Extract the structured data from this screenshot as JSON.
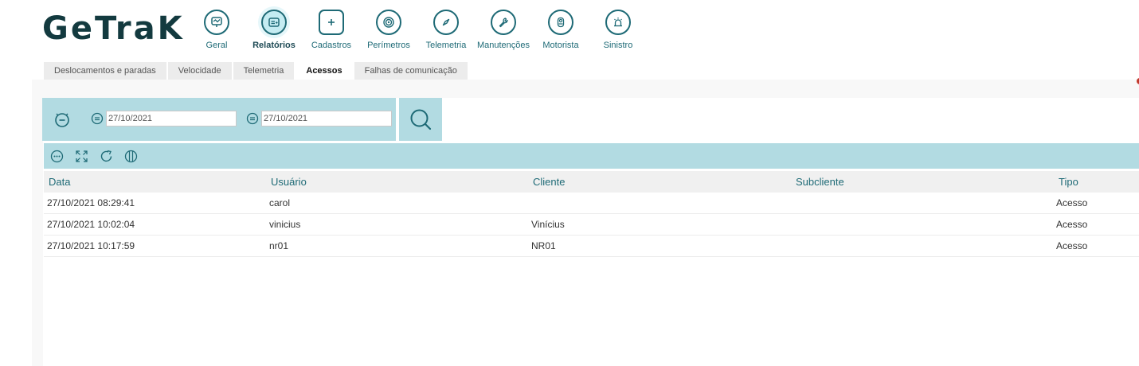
{
  "app": {
    "logo": "GeTraK"
  },
  "nav": [
    {
      "label": "Geral",
      "icon": "chart-monitor-icon",
      "active": false
    },
    {
      "label": "Relatórios",
      "icon": "report-icon",
      "active": true
    },
    {
      "label": "Cadastros",
      "icon": "folder-plus-icon",
      "active": false
    },
    {
      "label": "Perímetros",
      "icon": "target-icon",
      "active": false
    },
    {
      "label": "Telemetria",
      "icon": "compass-icon",
      "active": false
    },
    {
      "label": "Manutenções",
      "icon": "wrench-icon",
      "active": false
    },
    {
      "label": "Motorista",
      "icon": "driver-icon",
      "active": false
    },
    {
      "label": "Sinistro",
      "icon": "alarm-icon",
      "active": false
    }
  ],
  "tabs": [
    {
      "label": "Deslocamentos e paradas",
      "active": false
    },
    {
      "label": "Velocidade",
      "active": false
    },
    {
      "label": "Telemetria",
      "active": false
    },
    {
      "label": "Acessos",
      "active": true
    },
    {
      "label": "Falhas de comunicação",
      "active": false
    }
  ],
  "filter": {
    "start_date": "27/10/2021",
    "end_date": "27/10/2021"
  },
  "table": {
    "columns": [
      "Data",
      "Usuário",
      "Cliente",
      "Subcliente",
      "Tipo"
    ],
    "rows": [
      [
        "27/10/2021 08:29:41",
        "carol",
        "",
        "",
        "Acesso"
      ],
      [
        "27/10/2021 10:02:04",
        "vinicius",
        "Vinícius",
        "",
        "Acesso"
      ],
      [
        "27/10/2021 10:17:59",
        "nr01",
        "NR01",
        "",
        "Acesso"
      ]
    ]
  },
  "colors": {
    "accent": "#1e6a76",
    "panel": "#b2dbe2",
    "logo": "#133a3f"
  }
}
